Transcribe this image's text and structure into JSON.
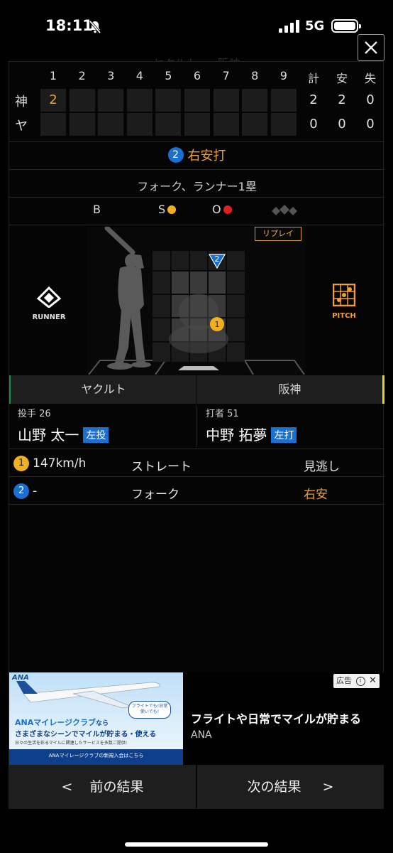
{
  "status": {
    "time": "18:11",
    "network": "5G"
  },
  "background_title": "ヤクルト vs 阪神",
  "scoreboard": {
    "innings": [
      "1",
      "2",
      "3",
      "4",
      "5",
      "6",
      "7",
      "8",
      "9"
    ],
    "totals_headers": [
      "計",
      "安",
      "失"
    ],
    "rows": [
      {
        "team": "神",
        "innings": [
          "2",
          "",
          "",
          "",
          "",
          "",
          "",
          "",
          ""
        ],
        "totals": [
          "2",
          "2",
          "0"
        ]
      },
      {
        "team": "ヤ",
        "innings": [
          "",
          "",
          "",
          "",
          "",
          "",
          "",
          "",
          ""
        ],
        "totals": [
          "0",
          "0",
          "0"
        ]
      }
    ]
  },
  "play": {
    "number": "2",
    "result": "右安打",
    "detail": "フォーク、ランナー1塁"
  },
  "count": {
    "b_label": "B",
    "s_label": "S",
    "o_label": "O",
    "balls": 0,
    "strikes": 1,
    "outs": 1
  },
  "field": {
    "replay_label": "リプレイ",
    "runner_label": "RUNNER",
    "pitch_label": "PITCH",
    "pitch_markers": [
      {
        "number": "1",
        "zone_col": 2,
        "zone_row": 2,
        "color": "#f0b020"
      },
      {
        "number": "2",
        "zone_col": 2,
        "zone_row": 0,
        "color": "#1a6fd1"
      }
    ]
  },
  "teams": {
    "left": "ヤクルト",
    "right": "阪神"
  },
  "pitcher": {
    "role": "投手 26",
    "name": "山野 太一",
    "hand": "左投"
  },
  "batter": {
    "role": "打者 51",
    "name": "中野 拓夢",
    "hand": "左打"
  },
  "pitches": [
    {
      "number": "1",
      "speed": "147km/h",
      "type": "ストレート",
      "result": "見逃し",
      "badge_color": "#f0b020",
      "result_color": "#e6e6e6"
    },
    {
      "number": "2",
      "speed": "-",
      "type": "フォーク",
      "result": "右安",
      "badge_color": "#1a6fd1",
      "result_color": "#f0a030"
    }
  ],
  "ad": {
    "label": "広告",
    "headline": "フライトや日常でマイルが貯まる",
    "brand": "ANA",
    "image_logo": "ANA",
    "image_title": "ANAマイレージクラブ",
    "image_title_suffix": "なら",
    "image_line2": "さまざまなシーンでマイルが貯まる・使える",
    "image_line3": "日々の生活を彩るマイルに関連したサービスを多数ご提供!",
    "image_bubble": "フライトでも!日常使いでも!",
    "image_footer": "ANAマイレージクラブの新規入会はこちら"
  },
  "nav": {
    "prev": "前の結果",
    "next": "次の結果"
  },
  "colors": {
    "accent_orange": "#f0a030",
    "badge_blue": "#1a6fd1",
    "strike_yellow": "#f0b020",
    "out_red": "#e02020",
    "left_team_bar": "#1a8a4a",
    "right_team_bar": "#e8d020"
  }
}
